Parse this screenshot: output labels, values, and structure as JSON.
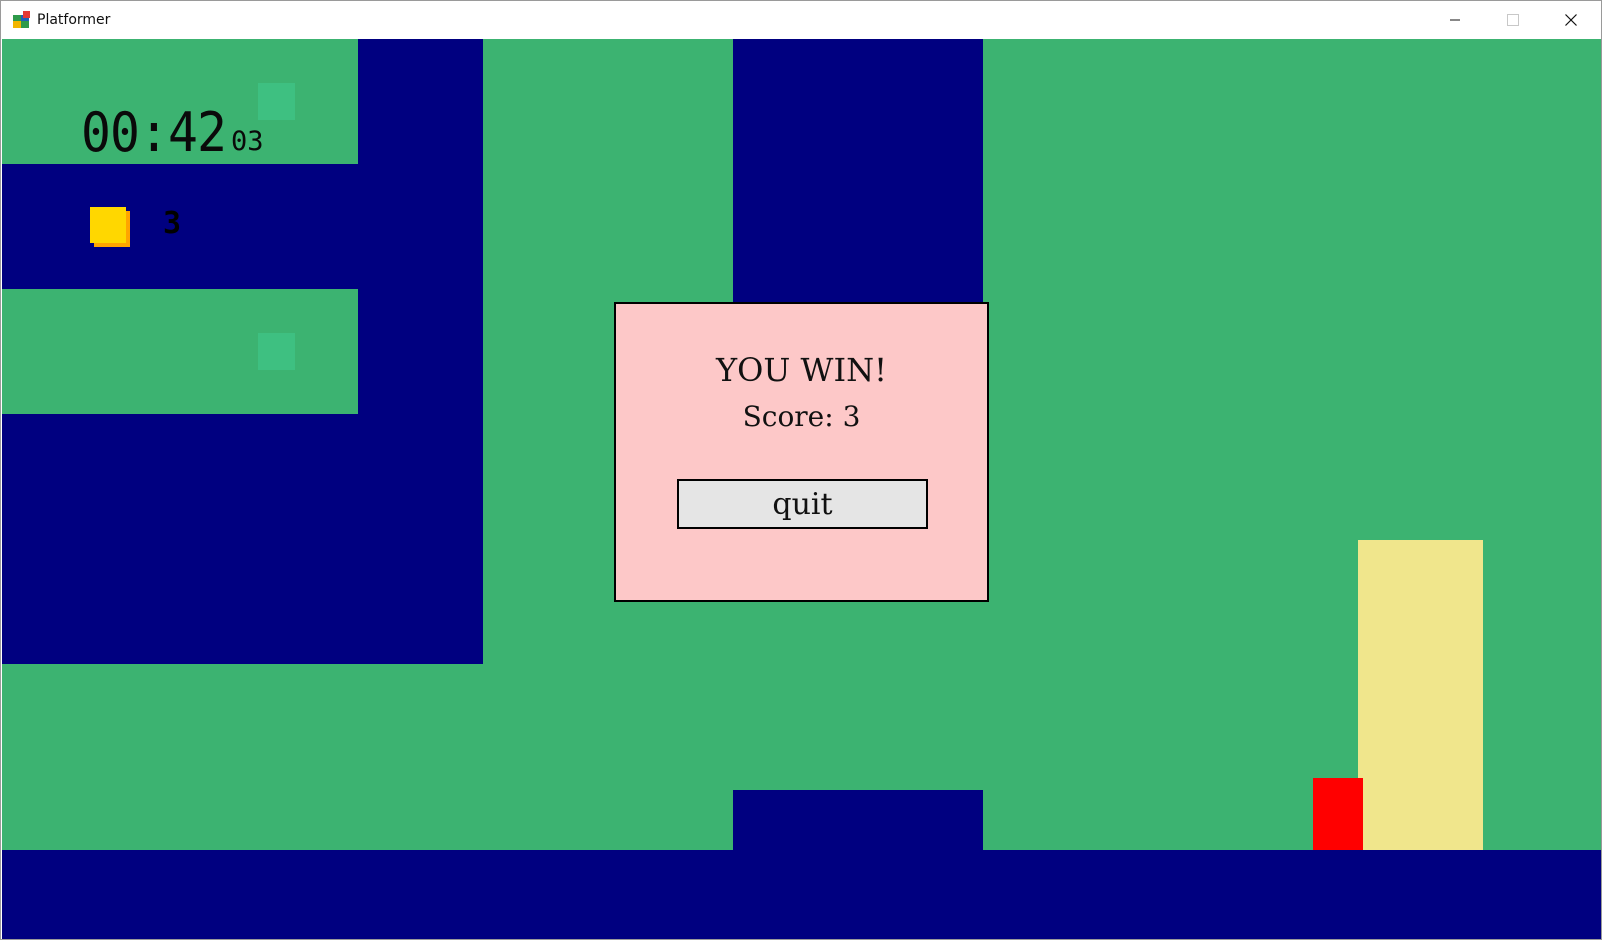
{
  "window": {
    "title": "Platformer",
    "controls": {
      "minimize_icon": "minimize-icon",
      "maximize_icon": "maximize-icon",
      "close_icon": "close-icon"
    }
  },
  "hud": {
    "timer": "00:42",
    "timer_fraction": "03",
    "coin_count": "3"
  },
  "dialog": {
    "title": "YOU WIN!",
    "score_text": "Score: 3",
    "quit_label": "quit"
  },
  "colors": {
    "sky": "#3cb371",
    "wall": "#000080",
    "goal": "#f0e68c",
    "player": "#ff0000",
    "coin": "#ffd700",
    "dialog_bg": "#fdc8c8"
  }
}
